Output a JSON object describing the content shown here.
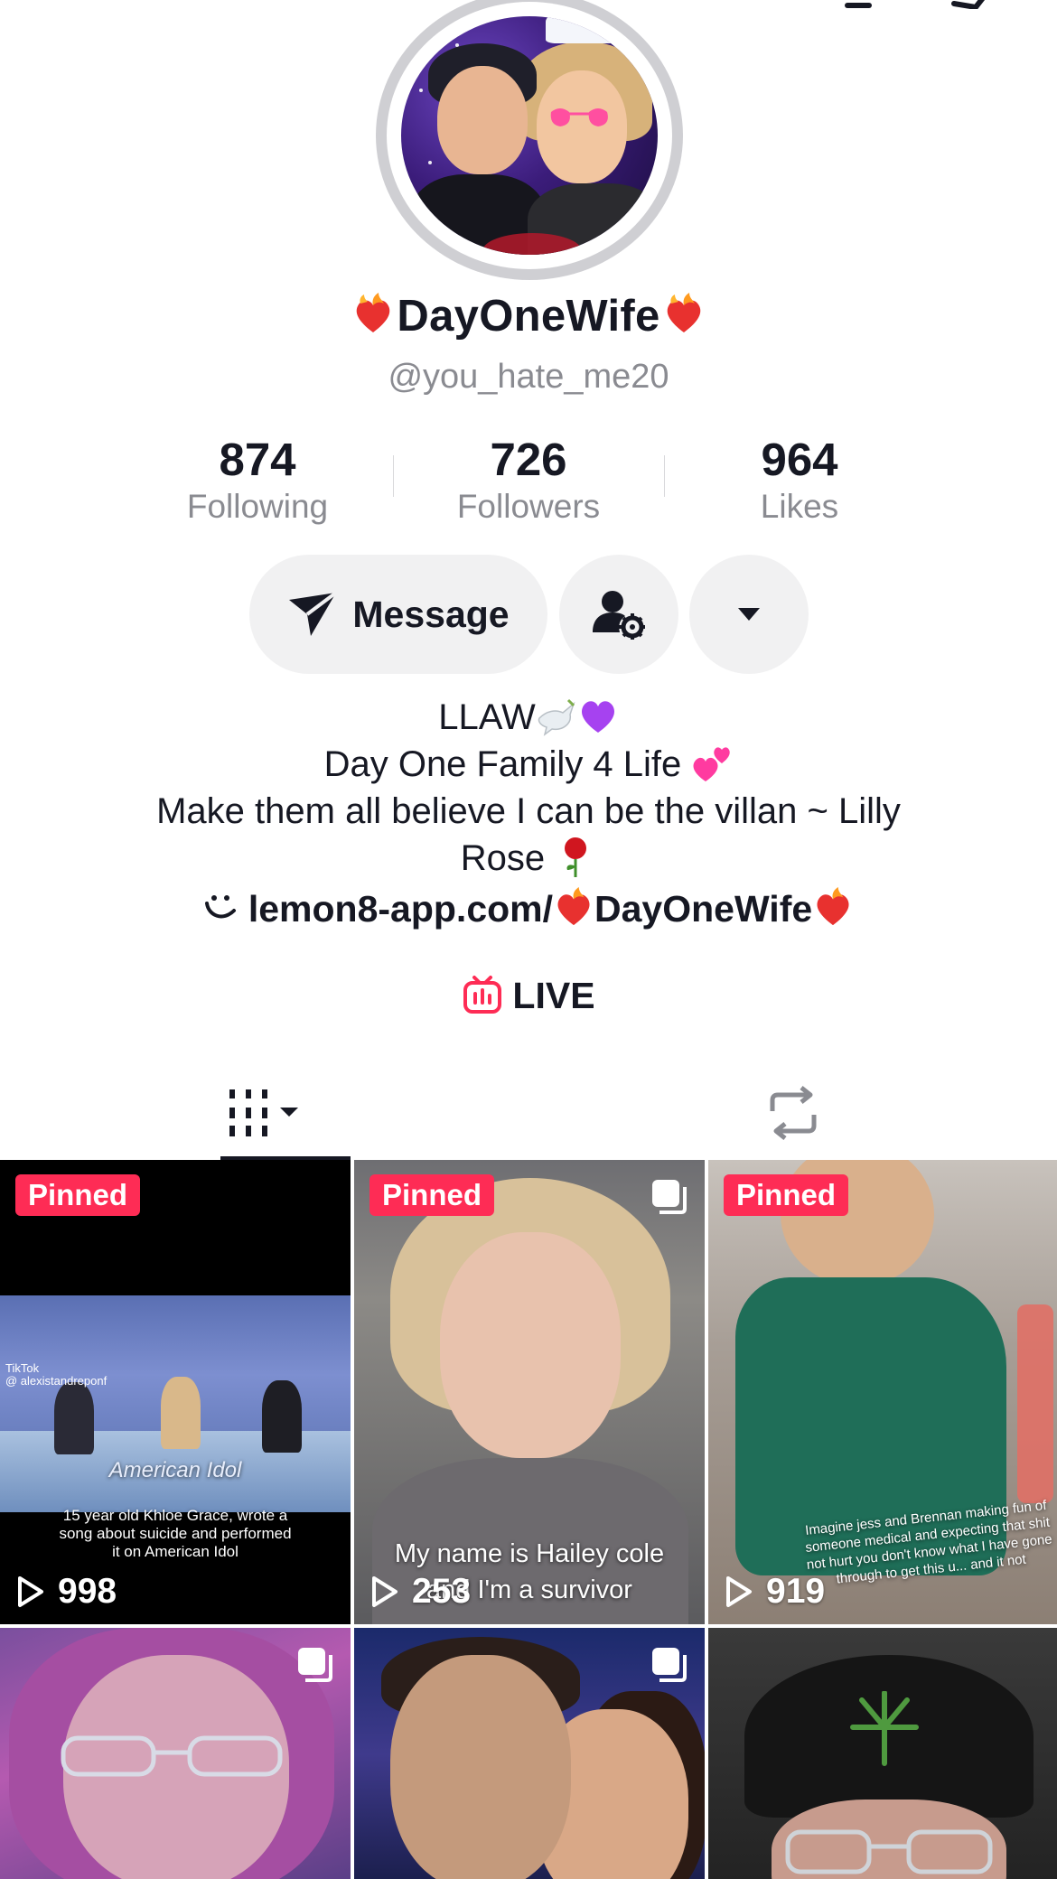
{
  "profile": {
    "display_name": "DayOneWife",
    "username": "@you_hate_me20",
    "avatar_icon": "couple-avatar-illustration"
  },
  "stats": [
    {
      "value": "874",
      "label": "Following"
    },
    {
      "value": "726",
      "label": "Followers"
    },
    {
      "value": "964",
      "label": "Likes"
    }
  ],
  "actions": {
    "message_label": "Message",
    "add_friend_icon": "user-settings-icon",
    "more_icon": "caret-down-icon"
  },
  "bio": {
    "line1": "LLAW",
    "line2": "Day One Family 4 Life",
    "line3": "Make them all believe I can be the villan ~ Lilly",
    "line4": "Rose",
    "link_text": "lemon8-app.com/",
    "link_suffix": "DayOneWife"
  },
  "live": {
    "label": "LIVE"
  },
  "tabs": [
    {
      "icon": "videos-grid-icon",
      "active": true
    },
    {
      "icon": "repost-icon",
      "active": false
    }
  ],
  "videos": [
    {
      "pinned": "Pinned",
      "views": "998",
      "caption": "15 year old Khloe Grace, wrote a song about suicide and performed it on American Idol",
      "brand": "American Idol",
      "watermark": "TikTok\n@ alexistandreponf"
    },
    {
      "pinned": "Pinned",
      "views": "253",
      "caption_line1": "My name is Hailey cole",
      "caption_line2": "and I'm a survivor",
      "multi": true
    },
    {
      "pinned": "Pinned",
      "views": "919",
      "caption": "Imagine jess and Brennan making fun of someone medical and expecting that shit not hurt you don't know what I have gone through to get this u... and it not"
    },
    {
      "multi": true
    },
    {
      "multi": true
    },
    {}
  ],
  "colors": {
    "accent": "#fe2c55",
    "text": "#161823",
    "muted": "#8a8b91",
    "button_bg": "#f1f1f2"
  }
}
